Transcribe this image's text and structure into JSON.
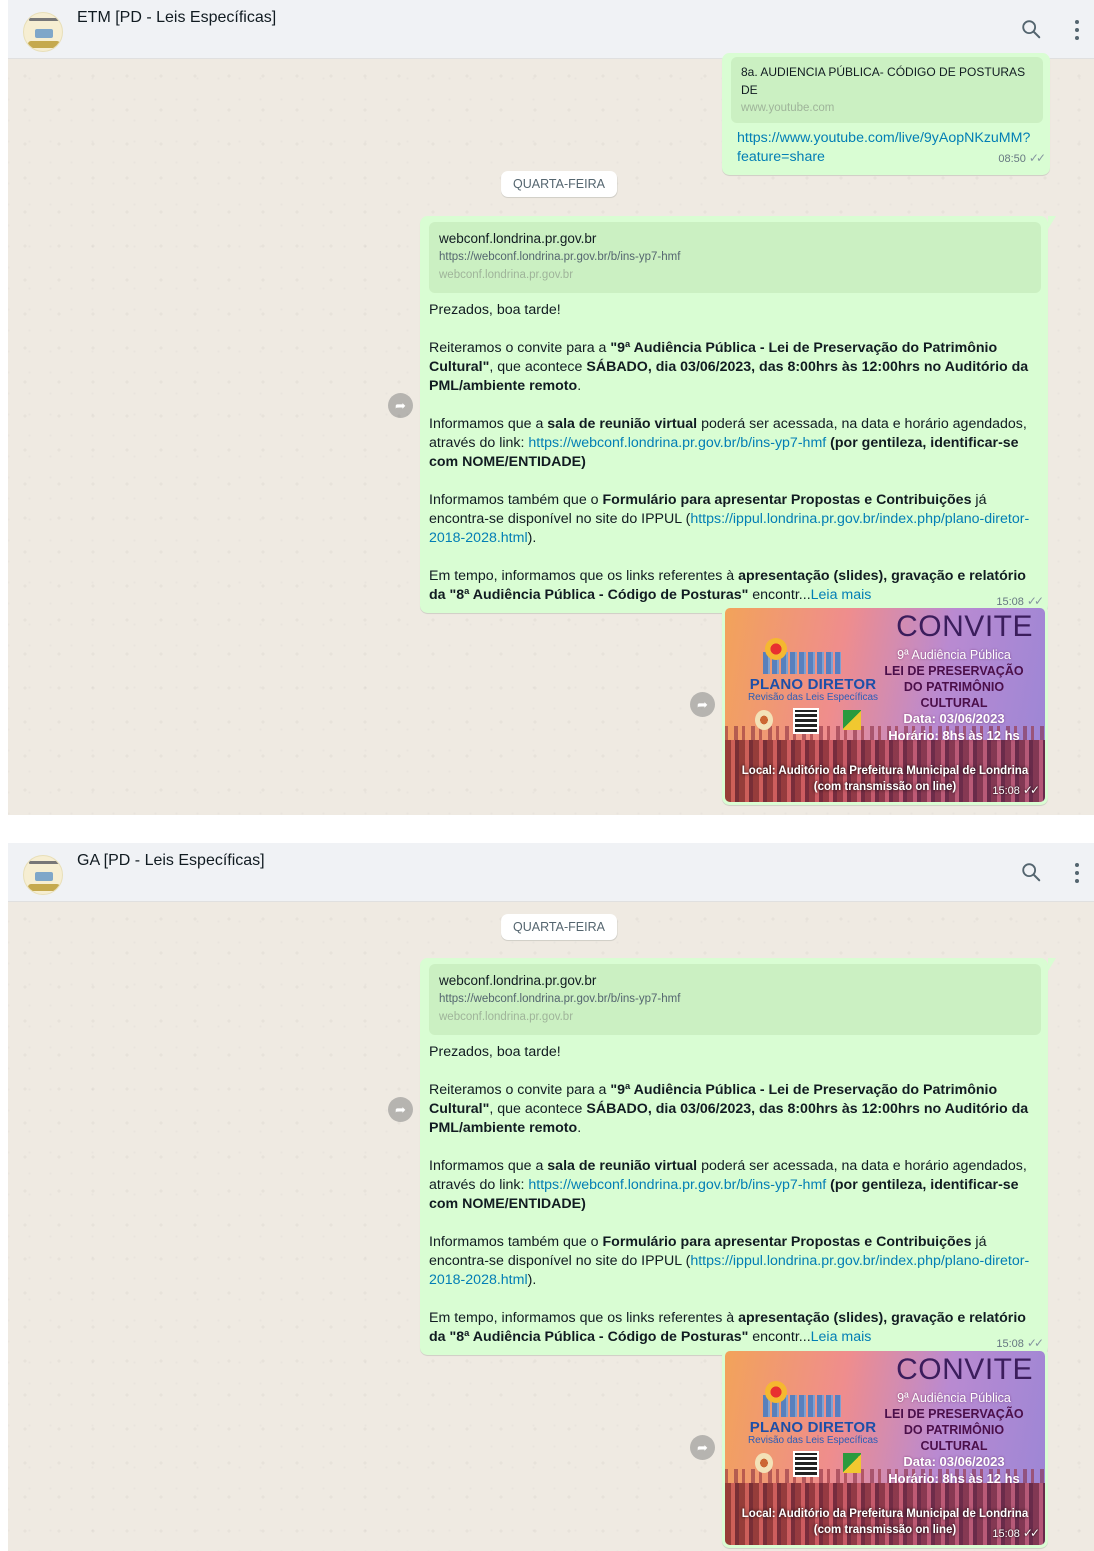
{
  "colors": {
    "bubble_out": "#d9fdd3",
    "link": "#027eb5",
    "header_bg": "#f0f2f5",
    "chat_bg": "#efeae2"
  },
  "panels": [
    {
      "chat_title": "ETM [PD - Leis Específicas]",
      "icons": {
        "search": "search-icon",
        "menu": "menu-dots-icon"
      },
      "prev_message": {
        "preview_title": "8a. AUDIENCIA PÚBLICA- CÓDIGO DE POSTURAS DE",
        "preview_host": "www.youtube.com",
        "link_line1": "https://www.youtube.com/live/9yAopNKzuMM?",
        "link_line2": "feature=share",
        "time": "08:50"
      },
      "day": "QUARTA-FEIRA",
      "message": {
        "preview_title": "webconf.londrina.pr.gov.br",
        "preview_desc": "https://webconf.londrina.pr.gov.br/b/ins-yp7-hmf",
        "preview_host": "webconf.londrina.pr.gov.br",
        "time": "15:08"
      },
      "image_time": "15:08"
    },
    {
      "chat_title": "GA [PD - Leis Específicas]",
      "icons": {
        "search": "search-icon",
        "menu": "menu-dots-icon"
      },
      "day": "QUARTA-FEIRA",
      "message": {
        "preview_title": "webconf.londrina.pr.gov.br",
        "preview_desc": "https://webconf.londrina.pr.gov.br/b/ins-yp7-hmf",
        "preview_host": "webconf.londrina.pr.gov.br",
        "time": "15:08"
      },
      "image_time": "15:08"
    }
  ],
  "message_text": {
    "greeting": "Prezados, boa tarde!",
    "p2_a": "Reiteramos o convite para a ",
    "p2_b": "\"9ª Audiência Pública - Lei de Preservação do Patrimônio Cultural\"",
    "p2_c": ", que acontece ",
    "p2_d": "SÁBADO, dia 03/06/2023, das 8:00hrs às 12:00hrs no Auditório da PML/ambiente remoto",
    "p2_e": ".",
    "p3_a": "Informamos que a ",
    "p3_b": "sala de reunião virtual",
    "p3_c": " poderá ser acessada, na data e horário agendados, através do link: ",
    "p3_link": "https://webconf.londrina.pr.gov.br/b/ins-yp7-hmf",
    "p3_d": " ",
    "p3_e": "(por gentileza, identificar-se com NOME/ENTIDADE)",
    "p4_a": "Informamos também que o ",
    "p4_b": "Formulário para apresentar Propostas e Contribuições",
    "p4_c": " já encontra-se disponível no site do IPPUL (",
    "p4_link": "https://ippul.londrina.pr.gov.br/index.php/plano-diretor-2018-2028.html",
    "p4_d": ").",
    "p5_a": "Em tempo, informamos que os links referentes à ",
    "p5_b": "apresentação (slides), gravação e relatório da \"8ª Audiência Pública - Código de Posturas\"",
    "p5_c": " encontr...",
    "read_more": "Leia mais"
  },
  "poster": {
    "convite": "CONVITE",
    "line1": "9ª Audiência Pública",
    "line2": "LEI DE PRESERVAÇÃO",
    "line3": "DO PATRIMÔNIO",
    "line4": "CULTURAL",
    "line5": "Data: 03/06/2023",
    "line6": "Horário: 8hs às 12 hs",
    "plano_diretor": "PLANO DIRETOR",
    "revisao": "Revisão das Leis Específicas",
    "local": "Local: Auditório da Prefeitura Municipal de Londrina",
    "transmissao": "(com transmissão on line)"
  },
  "ticks": "✓✓",
  "forward_glyph": "➦"
}
